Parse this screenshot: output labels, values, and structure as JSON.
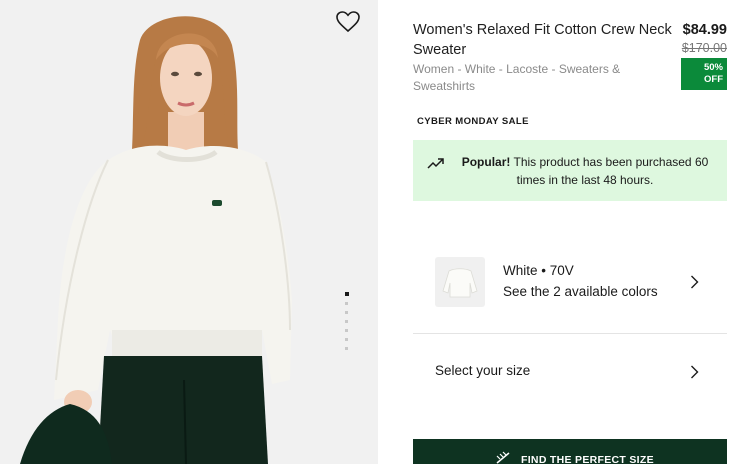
{
  "product": {
    "title": "Women's Relaxed Fit Cotton Crew Neck Sweater",
    "price": "$84.99",
    "old_price": "$170.00",
    "discount_line1": "50%",
    "discount_line2": "OFF",
    "breadcrumb": "Women - White - Lacoste - Sweaters & Sweatshirts",
    "sale_tag": "CYBER MONDAY SALE"
  },
  "popular": {
    "strong": "Popular!",
    "text": " This product has been purchased 60 times in the last 48 hours."
  },
  "color": {
    "name": "White • 70V",
    "sub": "See the 2 available colors"
  },
  "size": {
    "label": "Select your size"
  },
  "fit_button": {
    "label": "FIND THE PERFECT SIZE"
  },
  "gallery": {
    "slide_count": 7,
    "active_slide": 1
  },
  "colors": {
    "sale_green": "#0b8a3a",
    "popular_bg": "#def8df",
    "button_dark": "#0e3321",
    "sweater": "#f4f3ee",
    "pants": "#12271d"
  },
  "icons": [
    "heart-outline-icon",
    "trending-up-icon",
    "chevron-right-icon",
    "ruler-icon"
  ]
}
